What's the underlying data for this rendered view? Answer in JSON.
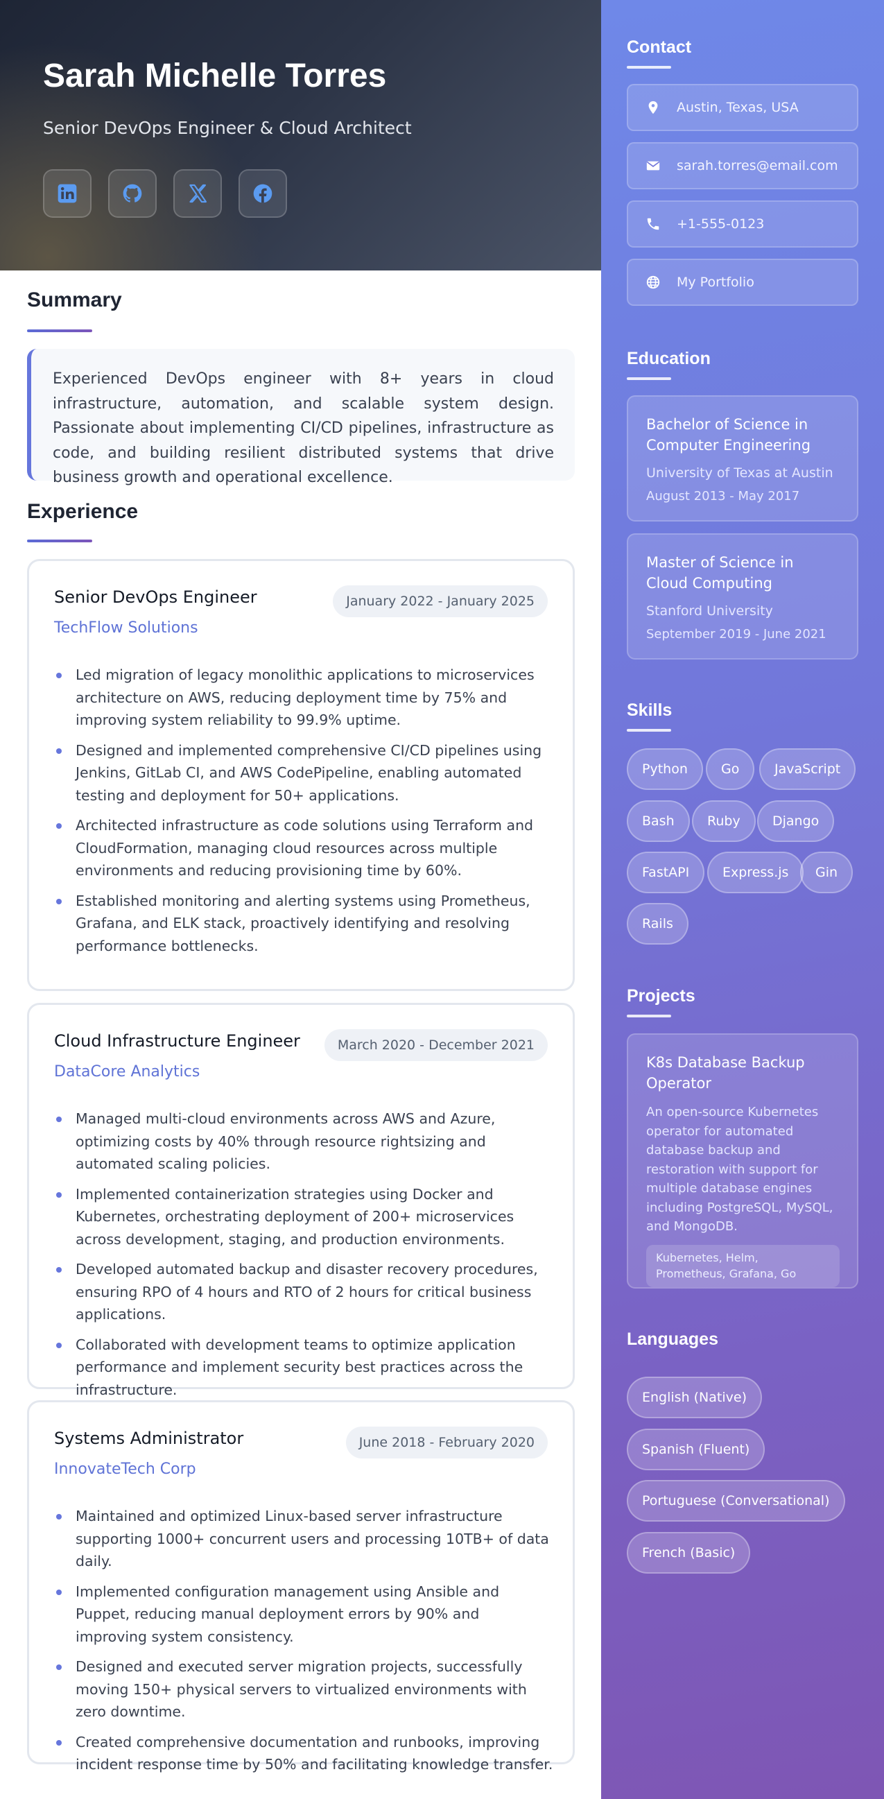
{
  "header": {
    "name": "Sarah Michelle Torres",
    "role": "Senior DevOps Engineer & Cloud Architect",
    "socials": [
      "linkedin-icon",
      "github-icon",
      "x-icon",
      "facebook-icon"
    ]
  },
  "summary": {
    "heading": "Summary",
    "text": "Experienced DevOps engineer with 8+ years in cloud infrastructure, automation, and scalable system design. Passionate about implementing CI/CD pipelines, infrastructure as code, and building resilient distributed systems that drive business growth and operational excellence."
  },
  "experience": {
    "heading": "Experience",
    "jobs": [
      {
        "title": "Senior DevOps Engineer",
        "company": "TechFlow Solutions",
        "dates": "January 2022 - January 2025",
        "bullets": [
          "Led migration of legacy monolithic applications to microservices architecture on AWS, reducing deployment time by 75% and improving system reliability to 99.9% uptime.",
          "Designed and implemented comprehensive CI/CD pipelines using Jenkins, GitLab CI, and AWS CodePipeline, enabling automated testing and deployment for 50+ applications.",
          "Architected infrastructure as code solutions using Terraform and CloudFormation, managing cloud resources across multiple environments and reducing provisioning time by 60%.",
          "Established monitoring and alerting systems using Prometheus, Grafana, and ELK stack, proactively identifying and resolving performance bottlenecks."
        ]
      },
      {
        "title": "Cloud Infrastructure Engineer",
        "company": "DataCore Analytics",
        "dates": "March 2020 - December 2021",
        "bullets": [
          "Managed multi-cloud environments across AWS and Azure, optimizing costs by 40% through resource rightsizing and automated scaling policies.",
          "Implemented containerization strategies using Docker and Kubernetes, orchestrating deployment of 200+ microservices across development, staging, and production environments.",
          "Developed automated backup and disaster recovery procedures, ensuring RPO of 4 hours and RTO of 2 hours for critical business applications.",
          "Collaborated with development teams to optimize application performance and implement security best practices across the infrastructure."
        ]
      },
      {
        "title": "Systems Administrator",
        "company": "InnovateTech Corp",
        "dates": "June 2018 - February 2020",
        "bullets": [
          "Maintained and optimized Linux-based server infrastructure supporting 1000+ concurrent users and processing 10TB+ of data daily.",
          "Implemented configuration management using Ansible and Puppet, reducing manual deployment errors by 90% and improving system consistency.",
          "Designed and executed server migration projects, successfully moving 150+ physical servers to virtualized environments with zero downtime.",
          "Created comprehensive documentation and runbooks, improving incident response time by 50% and facilitating knowledge transfer."
        ]
      }
    ]
  },
  "contact": {
    "heading": "Contact",
    "items": [
      {
        "icon": "location-pin-icon",
        "text": "Austin, Texas, USA"
      },
      {
        "icon": "envelope-icon",
        "text": "sarah.torres@email.com"
      },
      {
        "icon": "phone-icon",
        "text": "+1-555-0123"
      },
      {
        "icon": "globe-icon",
        "text": "My Portfolio"
      }
    ]
  },
  "education": {
    "heading": "Education",
    "items": [
      {
        "degree": "Bachelor of Science in Computer Engineering",
        "school": "University of Texas at Austin",
        "dates": "August 2013 - May 2017"
      },
      {
        "degree": "Master of Science in Cloud Computing",
        "school": "Stanford University",
        "dates": "September 2019 - June 2021"
      }
    ]
  },
  "skills": {
    "heading": "Skills",
    "items": [
      "Python",
      "Go",
      "JavaScript",
      "Bash",
      "Ruby",
      "Django",
      "FastAPI",
      "Express.js",
      "Gin",
      "Rails"
    ]
  },
  "projects": {
    "heading": "Projects",
    "items": [
      {
        "title": "K8s Database Backup Operator",
        "description": "An open-source Kubernetes operator for automated database backup and restoration with support for multiple database engines including PostgreSQL, MySQL, and MongoDB.",
        "tech": "Kubernetes, Helm, Prometheus, Grafana, Go"
      }
    ]
  },
  "languages": {
    "heading": "Languages",
    "items": [
      "English (Native)",
      "Spanish (Fluent)",
      "Portuguese (Conversational)",
      "French (Basic)"
    ]
  }
}
